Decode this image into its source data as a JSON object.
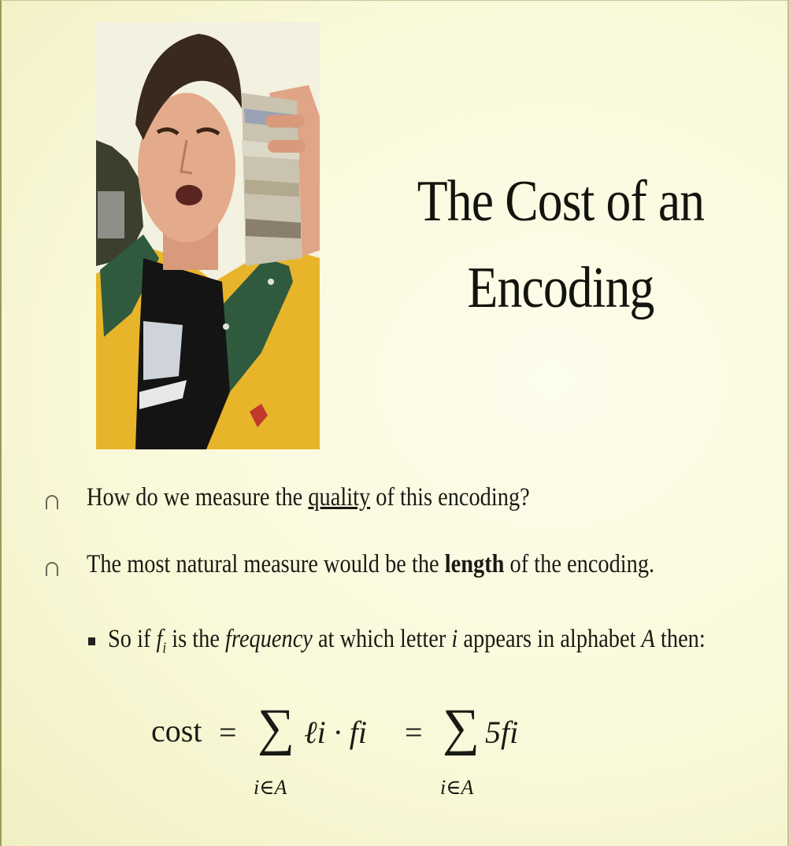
{
  "title": {
    "line1": "The Cost of an",
    "line2": "Encoding"
  },
  "bullets": [
    {
      "pre": "How do we measure the ",
      "link": "quality",
      "post": " of this encoding?"
    },
    {
      "pre": "The most natural measure would be the ",
      "bold": "length",
      "post": " of the encoding."
    }
  ],
  "subbullet": {
    "p1": "So if ",
    "f": "f",
    "i_sub": "i",
    "p2": " is the ",
    "freq": "frequency",
    "p3": " at which letter ",
    "letter": "i",
    "p4": " appears in alphabet ",
    "A": "A",
    "p5": " then:"
  },
  "formula": {
    "cost": "cost",
    "eq": "=",
    "sum": "∑",
    "term1": "ℓi · fi",
    "term2": "5fi",
    "under": "i∈A"
  }
}
